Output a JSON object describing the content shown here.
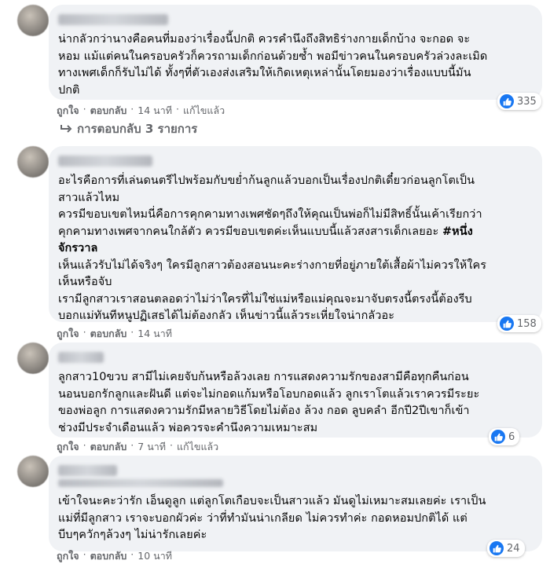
{
  "comments": [
    {
      "text": "น่ากลัวกว่านางคือคนที่มองว่าเรื่องนี้ปกติ ควรคำนึงถึงสิทธิร่างกายเด็กบ้าง จะกอด จะ\nหอม แม้แต่คนในครอบครัวก็ควรถามเด็กก่อนด้วยซ้ำ พอมีข่าวคนในครอบครัวล่วงละเมิด\nทางเพศเด็กก็รับไม่ได้ ทั้งๆที่ตัวเองส่งเสริมให้เกิดเหตุเหล่านั้นโดยมองว่าเรื่องแบบนี้มัน\nปกติ",
      "like": "ถูกใจ",
      "reply": "ตอบกลับ",
      "time": "14 นาที",
      "edited": "แก้ไขแล้ว",
      "reactions": "335"
    },
    {
      "text_a": "อะไรคือการที่เล่นดนตรีไปพร้อมกับขย่ำก้นลูกแล้วบอกเป็นเรื่องปกติเดี๋ยวก่อนลูกโตเป็น\nสาวแล้วไหม\nควรมีขอบเขตไหมนี่คือการคุกคามทางเพศชัดๆถึงให้คุณเป็นพ่อก็ไม่มีสิทธิ์นั้นเค้าเรียกว่า\nคุกคามทางเพศจากคนใกล้ตัว ควรมีขอบเขตค่ะเห็นแบบนี้แล้วสงสารเด็กเลยอะ ",
      "hashtag": "#หนึ่ง\nจักรวาล",
      "text_b": "\nเห็นแล้วรับไม่ได้จริงๆ ใครมีลูกสาวต้องสอนนะคะร่างกายที่อยู่ภายใต้เสื้อผ้าไม่ควรให้ใคร\nเห็นหรือจับ\nเรามีลูกสาวเราสอนตลอดว่าไม่ว่าใครที่ไม่ใช่แม่หรือแม่คุณจะมาจับตรงนี้ตรงนี้ต้องรีบ\nบอกแม่ทันทีหนูปฏิเสธได้ไม่ต้องกลัว เห็นข่าวนี้แล้วระเหี่ยใจน่ากลัวอะ",
      "like": "ถูกใจ",
      "reply": "ตอบกลับ",
      "time": "14 นาที",
      "reactions": "158"
    },
    {
      "text": "ลูกสาว10ขวบ สามีไม่เคยจับก้นหรือล้วงเลย การแสดงความรักของสามีคือทุกคืนก่อน\nนอนบอกรักลูกและฝันดี แต่จะไม่กอดแก้มหรือโอบกอดแล้ว ลูกเราโตแล้วเราควรมีระยะ\nของพ่อลูก การแสดงความรักมีหลายวิธีโดยไม่ต้อง ล้วง กอด ลูบคลำ อีกปี2ปีเขาก็เข้า\nช่วงมีประจำเดือนแล้ว พ่อควรจะคำนึงความเหมาะสม",
      "like": "ถูกใจ",
      "reply": "ตอบกลับ",
      "time": "7 นาที",
      "edited": "แก้ไขแล้ว",
      "reactions": "6"
    },
    {
      "text": "เข้าใจนะคะว่ารัก เอ็นดูลูก แต่ลูกโตเกือบจะเป็นสาวแล้ว มันดูไม่เหมาะสมเลยค่ะ เราเป็น\nแม่ที่มีลูกสาว เราจะบอกผัวค่ะ ว่าที่ทำมันน่าเกลียด ไม่ควรทำค่ะ กอดหอมปกติได้ แต่\nบีบๆควักๆล้วงๆ ไม่น่ารักเลยค่ะ",
      "like": "ถูกใจ",
      "reply": "ตอบกลับ",
      "time": "10 นาที",
      "reactions": "24"
    }
  ],
  "replies_label": "การตอบกลับ 3 รายการ",
  "colors": {
    "like_blue": "#1877f2",
    "bubble": "#f0f2f5",
    "meta": "#65676b"
  }
}
